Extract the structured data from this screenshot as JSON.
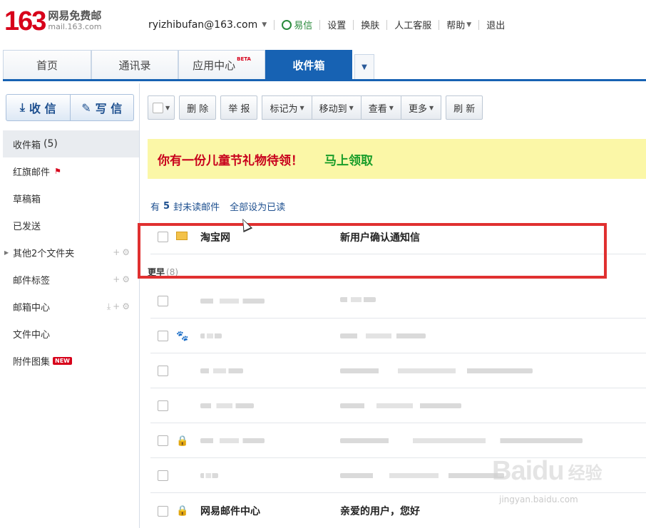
{
  "logo": {
    "number": "163",
    "name": "网易免费邮",
    "domain": "mail.163.com"
  },
  "topbar": {
    "user": "ryizhibufan@163.com",
    "yixin": "易信",
    "settings": "设置",
    "skin": "换肤",
    "service": "人工客服",
    "help": "帮助",
    "logout": "退出"
  },
  "tabs": [
    {
      "label": "首页"
    },
    {
      "label": "通讯录"
    },
    {
      "label": "应用中心",
      "badge": "BETA"
    },
    {
      "label": "收件箱"
    }
  ],
  "sidebar": {
    "receive": "收 信",
    "write": "写 信",
    "folders": [
      {
        "label": "收件箱",
        "count": "(5)"
      },
      {
        "label": "红旗邮件"
      },
      {
        "label": "草稿箱"
      },
      {
        "label": "已发送"
      },
      {
        "label": "其他2个文件夹"
      },
      {
        "label": "邮件标签"
      },
      {
        "label": "邮箱中心"
      },
      {
        "label": "文件中心"
      },
      {
        "label": "附件图集",
        "badge": "NEW"
      }
    ]
  },
  "toolbar": {
    "delete": "删 除",
    "report": "举 报",
    "mark": "标记为",
    "move": "移动到",
    "view": "查看",
    "more": "更多",
    "refresh": "刷 新"
  },
  "banner": {
    "text": "你有一份儿童节礼物待领！",
    "link": "马上领取"
  },
  "unread": {
    "prefix": "有",
    "count": "5",
    "suffix": "封未读邮件",
    "mark_all": "全部设为已读"
  },
  "mails": [
    {
      "from": "淘宝网",
      "subject": "新用户确认通知信"
    }
  ],
  "group": {
    "label": "更早",
    "count": "(8)"
  },
  "last_mail": {
    "from": "网易邮件中心",
    "subject": "亲爱的用户，您好"
  },
  "watermark": {
    "brand": "Baidu",
    "cn": "经验",
    "url": "jingyan.baidu.com"
  }
}
